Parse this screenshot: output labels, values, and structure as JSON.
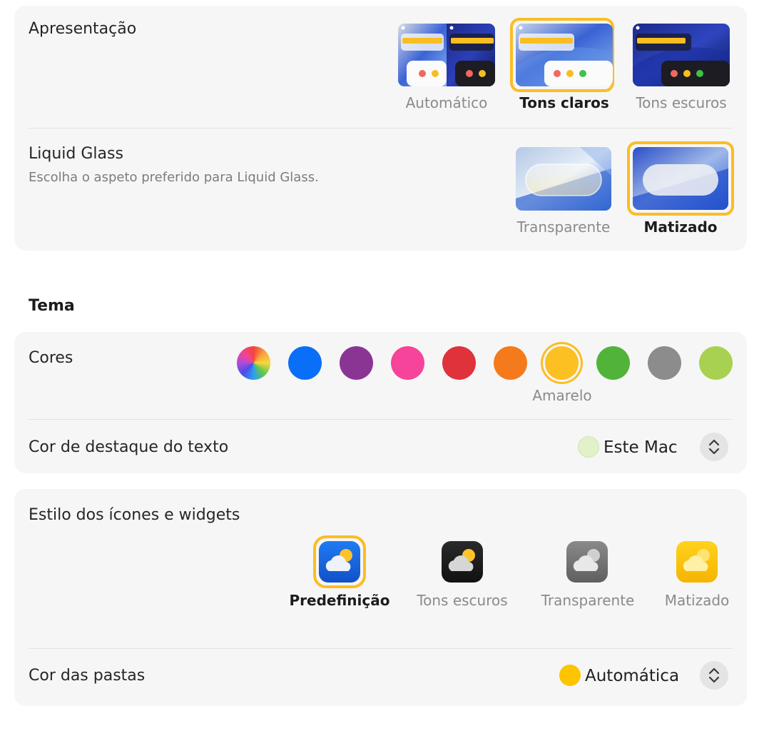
{
  "appearance": {
    "label": "Apresentação",
    "options": [
      {
        "label": "Automático",
        "selected": false
      },
      {
        "label": "Tons claros",
        "selected": true
      },
      {
        "label": "Tons escuros",
        "selected": false
      }
    ]
  },
  "liquid_glass": {
    "label": "Liquid Glass",
    "description": "Escolha o aspeto preferido para Liquid Glass.",
    "options": [
      {
        "label": "Transparente",
        "selected": false
      },
      {
        "label": "Matizado",
        "selected": true
      }
    ]
  },
  "theme": {
    "title": "Tema",
    "colors_label": "Cores",
    "selected_color_name": "Amarelo",
    "colors": [
      {
        "name": "multicolor",
        "hex": "multicolor"
      },
      {
        "name": "blue",
        "hex": "#0a6ff8"
      },
      {
        "name": "purple",
        "hex": "#8a3594"
      },
      {
        "name": "pink",
        "hex": "#f54499"
      },
      {
        "name": "red",
        "hex": "#e0323a"
      },
      {
        "name": "orange",
        "hex": "#f57a1c"
      },
      {
        "name": "yellow",
        "hex": "#fdc023"
      },
      {
        "name": "green",
        "hex": "#52b33a"
      },
      {
        "name": "graphite",
        "hex": "#8c8c8c"
      },
      {
        "name": "lime",
        "hex": "#a9d151"
      }
    ],
    "highlight_label": "Cor de destaque do texto",
    "highlight_value": "Este Mac",
    "highlight_swatch": "#e3f1c8"
  },
  "icons": {
    "label": "Estilo dos ícones e widgets",
    "options": [
      {
        "label": "Predefinição",
        "selected": true
      },
      {
        "label": "Tons escuros",
        "selected": false
      },
      {
        "label": "Transparente",
        "selected": false
      },
      {
        "label": "Matizado",
        "selected": false
      }
    ],
    "folder_label": "Cor das pastas",
    "folder_value": "Automática",
    "folder_swatch": "#fdc400"
  },
  "colors": {
    "accent": "#fbbd25",
    "card_bg": "#f6f6f6"
  }
}
